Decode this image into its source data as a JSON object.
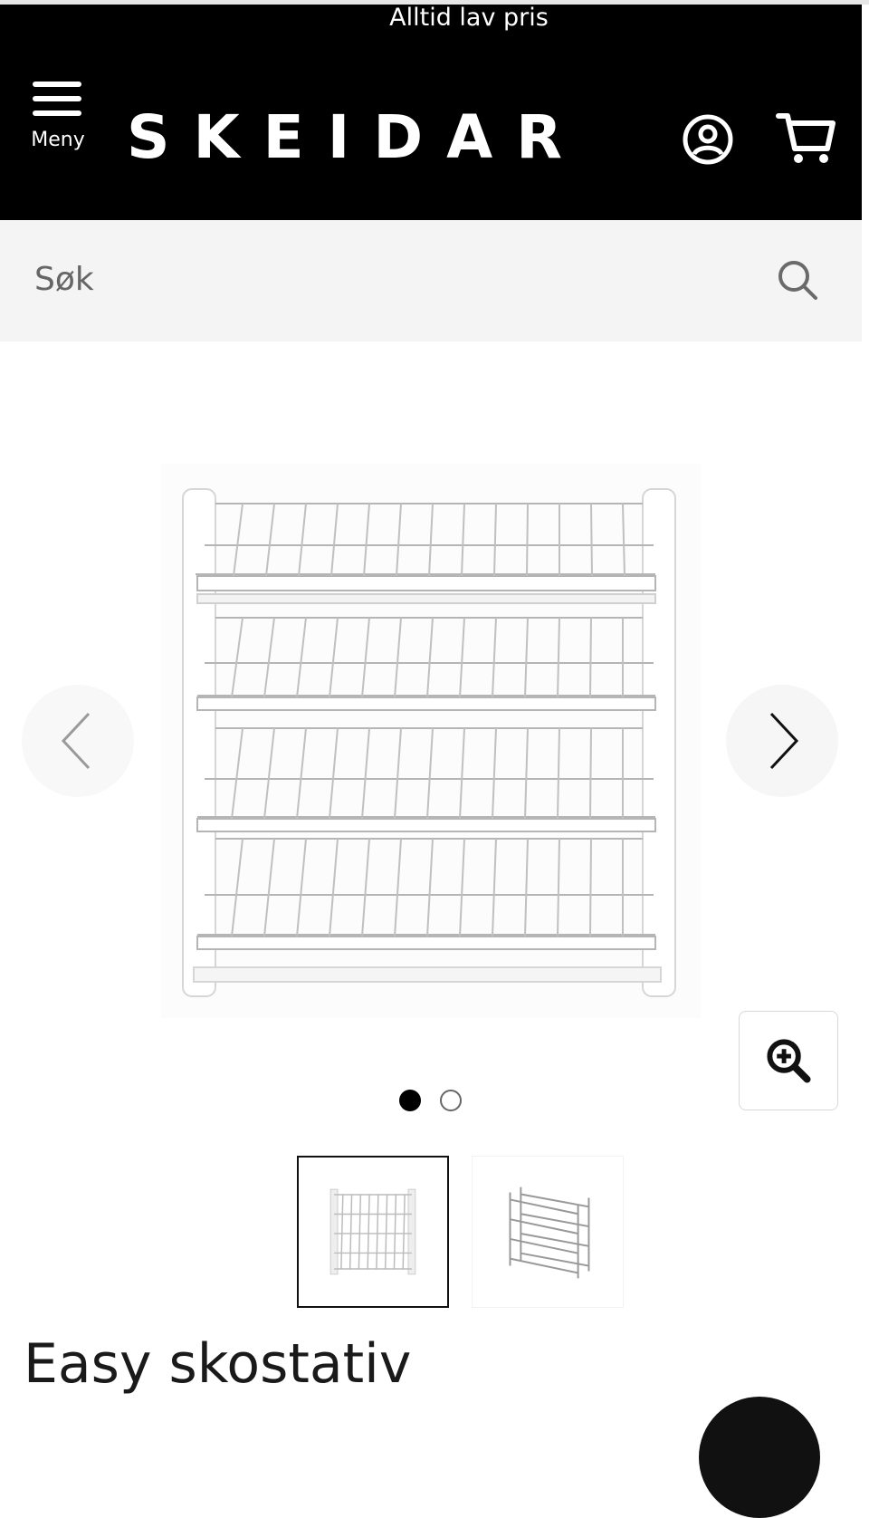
{
  "promo": {
    "text": "Alltid lav pris"
  },
  "header": {
    "menu_label": "Meny",
    "logo_text": "SKEIDAR",
    "account_icon": "account-icon",
    "cart_icon": "cart-icon"
  },
  "search": {
    "placeholder": "Søk",
    "icon": "search-icon"
  },
  "gallery": {
    "prev_icon": "chevron-left-icon",
    "next_icon": "chevron-right-icon",
    "zoom_icon": "zoom-in-icon",
    "image_count": 2,
    "active_index": 0
  },
  "product": {
    "title": "Easy skostativ"
  },
  "colors": {
    "header_bg": "#000000",
    "search_bg": "#f4f4f4",
    "text": "#111111",
    "white": "#ffffff"
  }
}
